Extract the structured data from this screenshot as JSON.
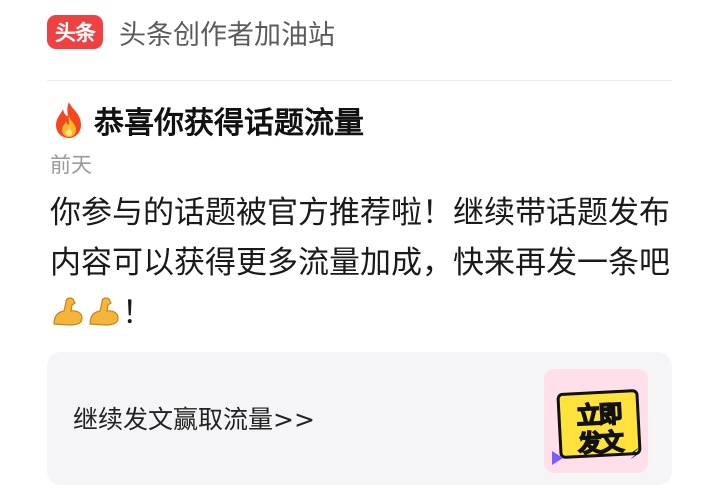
{
  "header": {
    "logo_text": "头条",
    "title": "头条创作者加油站"
  },
  "message": {
    "title": "恭喜你获得话题流量",
    "title_icon": "fire-icon",
    "time": "前天",
    "body": "你参与的话题被官方推荐啦！继续带话题发布内容可以获得更多流量加成，快来再发一条吧",
    "body_suffix": "！",
    "body_icons": [
      "flexed-biceps-icon",
      "flexed-biceps-icon"
    ]
  },
  "card": {
    "link_text": "继续发文赢取流量>>",
    "promo_line1": "立即",
    "promo_line2": "发文"
  },
  "colors": {
    "brand": "#f04142",
    "promo_bg": "#ffe23b",
    "card_bg": "#f5f5f7"
  }
}
